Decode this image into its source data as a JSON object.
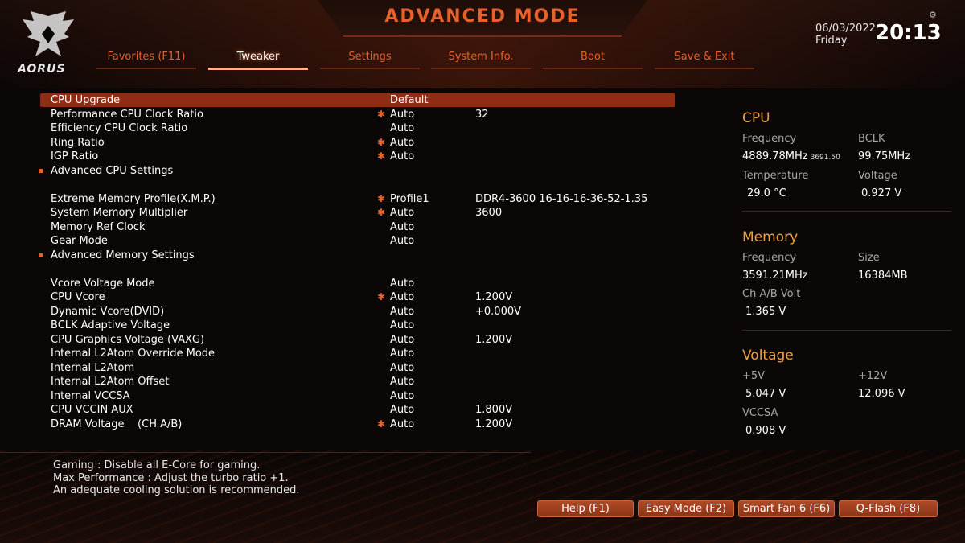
{
  "header": {
    "title": "ADVANCED MODE",
    "logo_text": "AORUS",
    "date": "06/03/2022",
    "day": "Friday",
    "time": "20:13"
  },
  "tabs": [
    {
      "label": "Favorites (F11)",
      "active": false
    },
    {
      "label": "Tweaker",
      "active": true
    },
    {
      "label": "Settings",
      "active": false
    },
    {
      "label": "System Info.",
      "active": false
    },
    {
      "label": "Boot",
      "active": false
    },
    {
      "label": "Save & Exit",
      "active": false
    }
  ],
  "settings": [
    {
      "label": "CPU Upgrade",
      "value": "Default",
      "extra": "",
      "star": false,
      "highlight": true
    },
    {
      "label": "Performance CPU Clock Ratio",
      "value": "Auto",
      "extra": "32",
      "star": true
    },
    {
      "label": "Efficiency CPU Clock Ratio",
      "value": "Auto",
      "extra": "",
      "star": false
    },
    {
      "label": "Ring Ratio",
      "value": "Auto",
      "extra": "",
      "star": true
    },
    {
      "label": "IGP Ratio",
      "value": "Auto",
      "extra": "",
      "star": true
    },
    {
      "label": "Advanced CPU Settings",
      "value": "",
      "extra": "",
      "star": false,
      "submenu": true
    },
    {
      "label": "Extreme Memory Profile(X.M.P.)",
      "value": "Profile1",
      "extra": "DDR4-3600 16-16-16-36-52-1.35",
      "star": true
    },
    {
      "label": "System Memory Multiplier",
      "value": "Auto",
      "extra": "3600",
      "star": true
    },
    {
      "label": "Memory Ref Clock",
      "value": "Auto",
      "extra": "",
      "star": false
    },
    {
      "label": "Gear Mode",
      "value": "Auto",
      "extra": "",
      "star": false
    },
    {
      "label": "Advanced Memory Settings",
      "value": "",
      "extra": "",
      "star": false,
      "submenu": true
    },
    {
      "label": "Vcore Voltage Mode",
      "value": "Auto",
      "extra": "",
      "star": false
    },
    {
      "label": "CPU Vcore",
      "value": "Auto",
      "extra": "1.200V",
      "star": true
    },
    {
      "label": "Dynamic Vcore(DVID)",
      "value": "Auto",
      "extra": "+0.000V",
      "star": false
    },
    {
      "label": "BCLK Adaptive Voltage",
      "value": "Auto",
      "extra": "",
      "star": false
    },
    {
      "label": "CPU Graphics Voltage (VAXG)",
      "value": "Auto",
      "extra": "1.200V",
      "star": false
    },
    {
      "label": "Internal L2Atom Override Mode",
      "value": "Auto",
      "extra": "",
      "star": false
    },
    {
      "label": "Internal L2Atom",
      "value": "Auto",
      "extra": "",
      "star": false
    },
    {
      "label": "Internal L2Atom Offset",
      "value": "Auto",
      "extra": "",
      "star": false
    },
    {
      "label": "Internal VCCSA",
      "value": "Auto",
      "extra": "",
      "star": false
    },
    {
      "label": "CPU VCCIN AUX",
      "value": "Auto",
      "extra": "1.800V",
      "star": false
    },
    {
      "label": "DRAM Voltage    (CH A/B)",
      "value": "Auto",
      "extra": "1.200V",
      "star": true
    }
  ],
  "monitor": {
    "cpu": {
      "title": "CPU",
      "freq_label": "Frequency",
      "freq_value": "4889.78MHz",
      "freq_small": "3691.50",
      "bclk_label": "BCLK",
      "bclk_value": "99.75MHz",
      "temp_label": "Temperature",
      "temp_value": "29.0 °C",
      "volt_label": "Voltage",
      "volt_value": "0.927 V"
    },
    "memory": {
      "title": "Memory",
      "freq_label": "Frequency",
      "freq_value": "3591.21MHz",
      "size_label": "Size",
      "size_value": "16384MB",
      "volt_label": "Ch A/B Volt",
      "volt_value": "1.365 V"
    },
    "voltage": {
      "title": "Voltage",
      "v5_label": "+5V",
      "v5_value": "5.047 V",
      "v12_label": "+12V",
      "v12_value": "12.096 V",
      "vccsa_label": "VCCSA",
      "vccsa_value": "0.908 V"
    }
  },
  "help_text": [
    "Gaming : Disable all E-Core for gaming.",
    "Max Performance : Adjust the turbo ratio +1.",
    "An adequate cooling solution is recommended."
  ],
  "buttons": [
    {
      "label": "Help (F1)"
    },
    {
      "label": "Easy Mode (F2)"
    },
    {
      "label": "Smart Fan 6 (F6)"
    },
    {
      "label": "Q-Flash (F8)"
    }
  ],
  "colors": {
    "accent": "#e8612a",
    "highlight_row": "#8e2c14",
    "section_title": "#f0a03c"
  }
}
